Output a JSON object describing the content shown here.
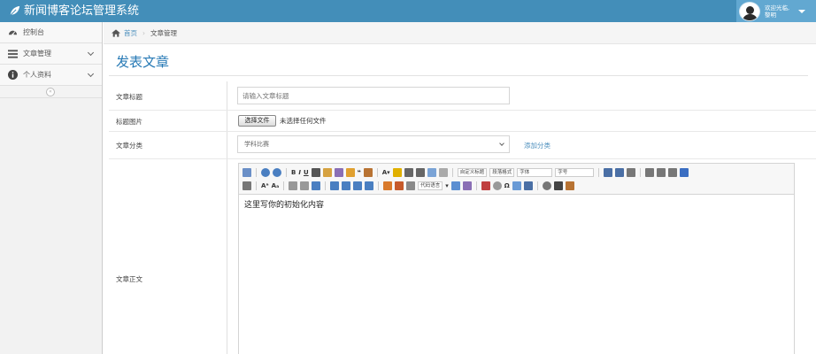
{
  "app": {
    "title": "新闻博客论坛管理系统"
  },
  "user": {
    "welcome_line1": "欢迎光临,",
    "welcome_line2": "黎明"
  },
  "sidebar": {
    "items": [
      {
        "label": "控制台",
        "icon": "dashboard-icon"
      },
      {
        "label": "文章管理",
        "icon": "list-icon"
      },
      {
        "label": "个人资料",
        "icon": "info-icon"
      }
    ],
    "collapse_glyph": "«"
  },
  "breadcrumb": {
    "home": "首页",
    "current": "文章管理"
  },
  "page": {
    "title": "发表文章"
  },
  "form": {
    "title_label": "文章标题",
    "title_placeholder": "请输入文章标题",
    "image_label": "标题图片",
    "file_button": "选择文件",
    "file_status": "未选择任何文件",
    "category_label": "文章分类",
    "category_value": "学科比赛",
    "add_category": "添加分类",
    "body_label": "文章正文"
  },
  "editor": {
    "dropdowns": {
      "custom_title": "自定义标题",
      "paragraph_format": "段落格式",
      "font_family": "字体",
      "font_size": "字号",
      "code_language": "代码语言"
    },
    "initial_content": "这里写你的初始化内容"
  },
  "colors": {
    "topbar": "#438eb9",
    "accent": "#2679b5",
    "link": "#4c8fbd"
  }
}
